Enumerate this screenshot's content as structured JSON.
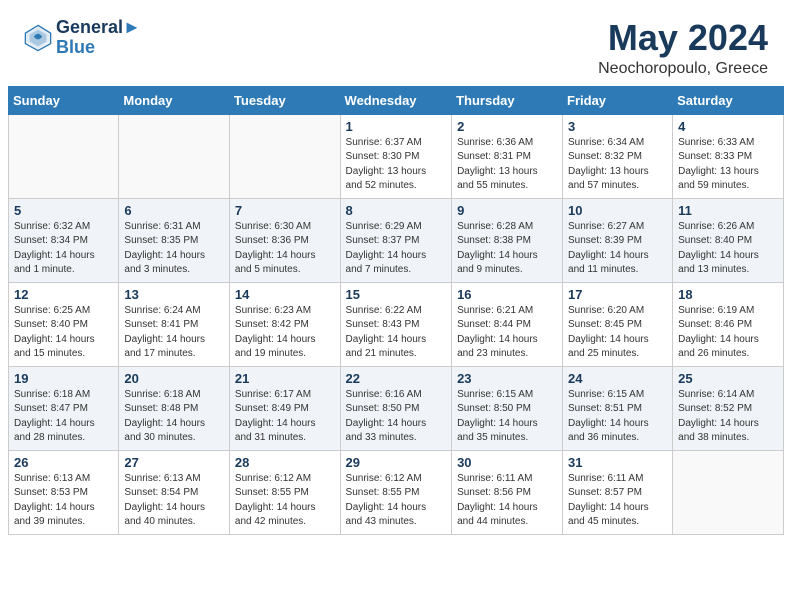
{
  "header": {
    "logo_line1": "General",
    "logo_line2": "Blue",
    "month": "May 2024",
    "location": "Neochoropoulo, Greece"
  },
  "days_of_week": [
    "Sunday",
    "Monday",
    "Tuesday",
    "Wednesday",
    "Thursday",
    "Friday",
    "Saturday"
  ],
  "weeks": [
    [
      {
        "day": "",
        "info": ""
      },
      {
        "day": "",
        "info": ""
      },
      {
        "day": "",
        "info": ""
      },
      {
        "day": "1",
        "info": "Sunrise: 6:37 AM\nSunset: 8:30 PM\nDaylight: 13 hours\nand 52 minutes."
      },
      {
        "day": "2",
        "info": "Sunrise: 6:36 AM\nSunset: 8:31 PM\nDaylight: 13 hours\nand 55 minutes."
      },
      {
        "day": "3",
        "info": "Sunrise: 6:34 AM\nSunset: 8:32 PM\nDaylight: 13 hours\nand 57 minutes."
      },
      {
        "day": "4",
        "info": "Sunrise: 6:33 AM\nSunset: 8:33 PM\nDaylight: 13 hours\nand 59 minutes."
      }
    ],
    [
      {
        "day": "5",
        "info": "Sunrise: 6:32 AM\nSunset: 8:34 PM\nDaylight: 14 hours\nand 1 minute."
      },
      {
        "day": "6",
        "info": "Sunrise: 6:31 AM\nSunset: 8:35 PM\nDaylight: 14 hours\nand 3 minutes."
      },
      {
        "day": "7",
        "info": "Sunrise: 6:30 AM\nSunset: 8:36 PM\nDaylight: 14 hours\nand 5 minutes."
      },
      {
        "day": "8",
        "info": "Sunrise: 6:29 AM\nSunset: 8:37 PM\nDaylight: 14 hours\nand 7 minutes."
      },
      {
        "day": "9",
        "info": "Sunrise: 6:28 AM\nSunset: 8:38 PM\nDaylight: 14 hours\nand 9 minutes."
      },
      {
        "day": "10",
        "info": "Sunrise: 6:27 AM\nSunset: 8:39 PM\nDaylight: 14 hours\nand 11 minutes."
      },
      {
        "day": "11",
        "info": "Sunrise: 6:26 AM\nSunset: 8:40 PM\nDaylight: 14 hours\nand 13 minutes."
      }
    ],
    [
      {
        "day": "12",
        "info": "Sunrise: 6:25 AM\nSunset: 8:40 PM\nDaylight: 14 hours\nand 15 minutes."
      },
      {
        "day": "13",
        "info": "Sunrise: 6:24 AM\nSunset: 8:41 PM\nDaylight: 14 hours\nand 17 minutes."
      },
      {
        "day": "14",
        "info": "Sunrise: 6:23 AM\nSunset: 8:42 PM\nDaylight: 14 hours\nand 19 minutes."
      },
      {
        "day": "15",
        "info": "Sunrise: 6:22 AM\nSunset: 8:43 PM\nDaylight: 14 hours\nand 21 minutes."
      },
      {
        "day": "16",
        "info": "Sunrise: 6:21 AM\nSunset: 8:44 PM\nDaylight: 14 hours\nand 23 minutes."
      },
      {
        "day": "17",
        "info": "Sunrise: 6:20 AM\nSunset: 8:45 PM\nDaylight: 14 hours\nand 25 minutes."
      },
      {
        "day": "18",
        "info": "Sunrise: 6:19 AM\nSunset: 8:46 PM\nDaylight: 14 hours\nand 26 minutes."
      }
    ],
    [
      {
        "day": "19",
        "info": "Sunrise: 6:18 AM\nSunset: 8:47 PM\nDaylight: 14 hours\nand 28 minutes."
      },
      {
        "day": "20",
        "info": "Sunrise: 6:18 AM\nSunset: 8:48 PM\nDaylight: 14 hours\nand 30 minutes."
      },
      {
        "day": "21",
        "info": "Sunrise: 6:17 AM\nSunset: 8:49 PM\nDaylight: 14 hours\nand 31 minutes."
      },
      {
        "day": "22",
        "info": "Sunrise: 6:16 AM\nSunset: 8:50 PM\nDaylight: 14 hours\nand 33 minutes."
      },
      {
        "day": "23",
        "info": "Sunrise: 6:15 AM\nSunset: 8:50 PM\nDaylight: 14 hours\nand 35 minutes."
      },
      {
        "day": "24",
        "info": "Sunrise: 6:15 AM\nSunset: 8:51 PM\nDaylight: 14 hours\nand 36 minutes."
      },
      {
        "day": "25",
        "info": "Sunrise: 6:14 AM\nSunset: 8:52 PM\nDaylight: 14 hours\nand 38 minutes."
      }
    ],
    [
      {
        "day": "26",
        "info": "Sunrise: 6:13 AM\nSunset: 8:53 PM\nDaylight: 14 hours\nand 39 minutes."
      },
      {
        "day": "27",
        "info": "Sunrise: 6:13 AM\nSunset: 8:54 PM\nDaylight: 14 hours\nand 40 minutes."
      },
      {
        "day": "28",
        "info": "Sunrise: 6:12 AM\nSunset: 8:55 PM\nDaylight: 14 hours\nand 42 minutes."
      },
      {
        "day": "29",
        "info": "Sunrise: 6:12 AM\nSunset: 8:55 PM\nDaylight: 14 hours\nand 43 minutes."
      },
      {
        "day": "30",
        "info": "Sunrise: 6:11 AM\nSunset: 8:56 PM\nDaylight: 14 hours\nand 44 minutes."
      },
      {
        "day": "31",
        "info": "Sunrise: 6:11 AM\nSunset: 8:57 PM\nDaylight: 14 hours\nand 45 minutes."
      },
      {
        "day": "",
        "info": ""
      }
    ]
  ]
}
